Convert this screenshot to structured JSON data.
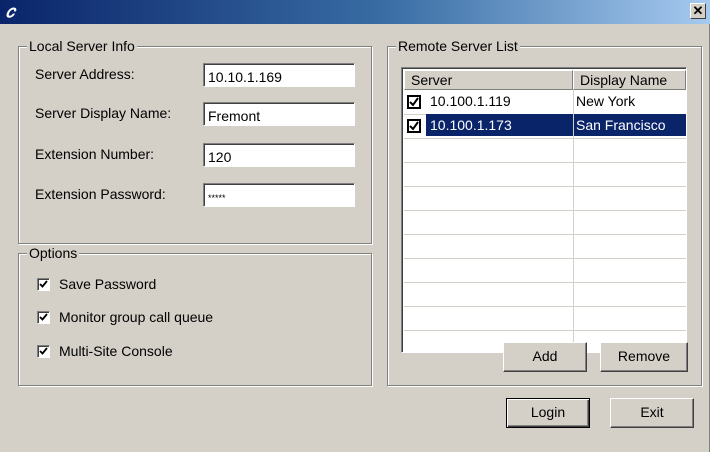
{
  "window": {
    "title": "",
    "close_glyph": "✕"
  },
  "local_server": {
    "legend": "Local Server Info",
    "address_label": "Server Address:",
    "address_value": "10.10.1.169",
    "display_name_label": "Server Display Name:",
    "display_name_value": "Fremont",
    "extension_label": "Extension Number:",
    "extension_value": "120",
    "password_label": "Extension Password:",
    "password_value": "*****"
  },
  "options": {
    "legend": "Options",
    "items": [
      {
        "label": "Save Password",
        "checked": true
      },
      {
        "label": "Monitor group call queue",
        "checked": true
      },
      {
        "label": "Multi-Site Console",
        "checked": true
      }
    ]
  },
  "remote": {
    "legend": "Remote Server List",
    "columns": [
      "Server",
      "Display Name"
    ],
    "rows": [
      {
        "server": "10.100.1.119",
        "display_name": "New York",
        "checked": true,
        "selected": false
      },
      {
        "server": "10.100.1.173",
        "display_name": "San Francisco",
        "checked": true,
        "selected": true
      }
    ],
    "add_label": "Add",
    "remove_label": "Remove"
  },
  "footer": {
    "login_label": "Login",
    "exit_label": "Exit"
  }
}
